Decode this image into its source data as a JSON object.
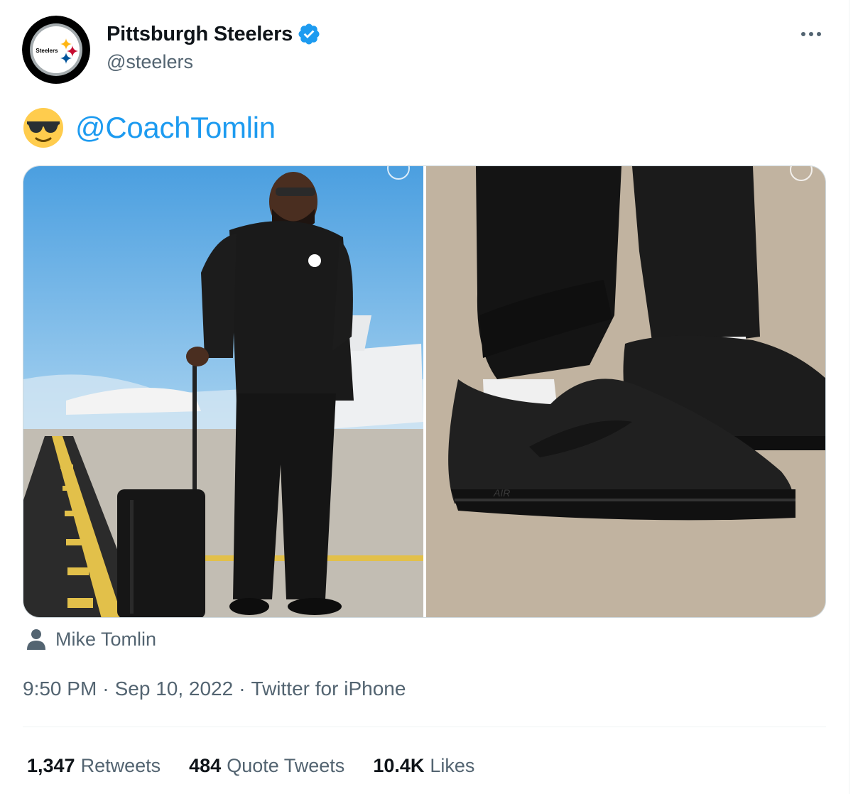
{
  "colors": {
    "accent": "#1d9bf0",
    "secondary_text": "#536471",
    "primary_text": "#0f1419",
    "border": "#cfd9de"
  },
  "header": {
    "display_name": "Pittsburgh Steelers",
    "handle": "@steelers",
    "avatar_icon": "steelers-logo-icon",
    "avatar_text": "Steelers",
    "verified_icon": "verified-badge-icon",
    "more_icon": "more-horizontal-icon"
  },
  "tweet": {
    "emoji_icon": "smiling-face-with-sunglasses-icon",
    "mention": "@CoachTomlin"
  },
  "media": [
    {
      "icon": "photo-coach-luggage"
    },
    {
      "icon": "photo-black-sneakers",
      "text": "AIR"
    }
  ],
  "tag": {
    "icon": "person-icon",
    "name": "Mike Tomlin"
  },
  "meta": {
    "time": "9:50 PM",
    "separator": "·",
    "date": "Sep 10, 2022",
    "source": "Twitter for iPhone"
  },
  "stats": [
    {
      "count": "1,347",
      "label": "Retweets"
    },
    {
      "count": "484",
      "label": "Quote Tweets"
    },
    {
      "count": "10.4K",
      "label": "Likes"
    }
  ]
}
